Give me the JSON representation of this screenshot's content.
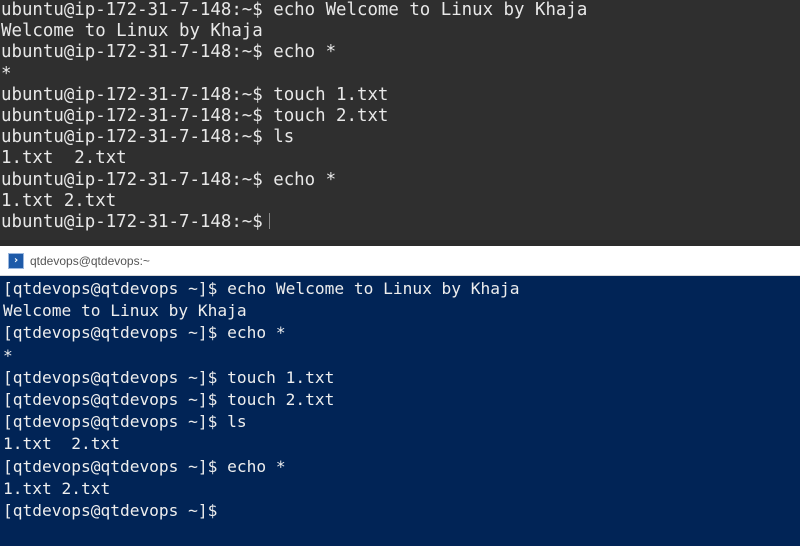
{
  "top_terminal": {
    "lines": [
      "ubuntu@ip-172-31-7-148:~$ echo Welcome to Linux by Khaja",
      "Welcome to Linux by Khaja",
      "ubuntu@ip-172-31-7-148:~$ echo *",
      "*",
      "ubuntu@ip-172-31-7-148:~$ touch 1.txt",
      "ubuntu@ip-172-31-7-148:~$ touch 2.txt",
      "ubuntu@ip-172-31-7-148:~$ ls",
      "1.txt  2.txt",
      "ubuntu@ip-172-31-7-148:~$ echo *",
      "1.txt 2.txt",
      "ubuntu@ip-172-31-7-148:~$"
    ],
    "background_color": "#2f2f2f",
    "text_color": "#e8e8e8"
  },
  "bottom_window": {
    "title": "qtdevops@qtdevops:~",
    "title_icon": "powershell-icon",
    "lines": [
      "[qtdevops@qtdevops ~]$ echo Welcome to Linux by Khaja",
      "Welcome to Linux by Khaja",
      "[qtdevops@qtdevops ~]$ echo *",
      "*",
      "[qtdevops@qtdevops ~]$ touch 1.txt",
      "[qtdevops@qtdevops ~]$ touch 2.txt",
      "[qtdevops@qtdevops ~]$ ls",
      "1.txt  2.txt",
      "[qtdevops@qtdevops ~]$ echo *",
      "1.txt 2.txt",
      "[qtdevops@qtdevops ~]$"
    ],
    "background_color": "#012456",
    "text_color": "#eeeeee"
  }
}
